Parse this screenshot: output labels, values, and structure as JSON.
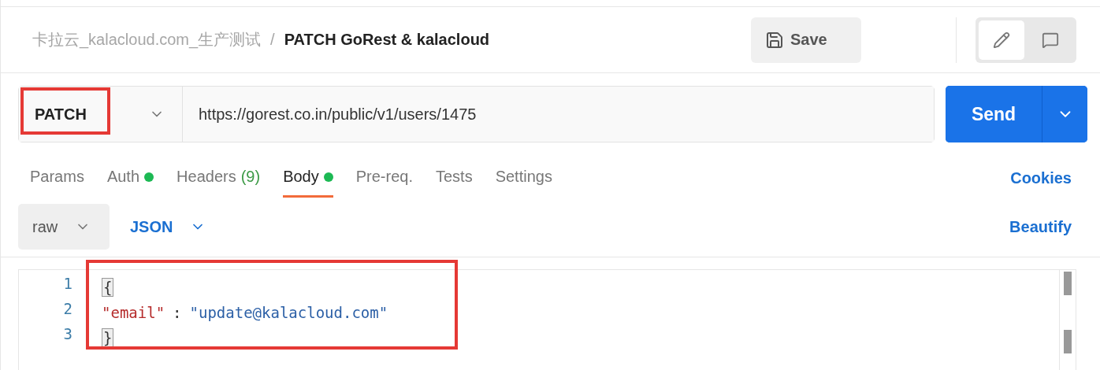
{
  "breadcrumb": {
    "collection": "卡拉云_kalacloud.com_生产测试",
    "separator": "/",
    "request": "PATCH GoRest & kalacloud"
  },
  "save_button": {
    "label": "Save"
  },
  "view_modes": [
    {
      "kind": "edit",
      "selected": true
    },
    {
      "kind": "comment",
      "selected": false
    }
  ],
  "request": {
    "method": "PATCH",
    "method_highlighted": true,
    "url": "https://gorest.co.in/public/v1/users/1475",
    "send": "Send"
  },
  "tabs": [
    {
      "label": "Params",
      "selected": false,
      "dot": false
    },
    {
      "label": "Auth",
      "selected": false,
      "dot": true
    },
    {
      "label": "Headers",
      "count": "(9)",
      "selected": false,
      "dot": false
    },
    {
      "label": "Body",
      "selected": true,
      "dot": true
    },
    {
      "label": "Pre-req.",
      "selected": false,
      "dot": false
    },
    {
      "label": "Tests",
      "selected": false,
      "dot": false
    },
    {
      "label": "Settings",
      "selected": false,
      "dot": false
    }
  ],
  "cookies_link": "Cookies",
  "body_options": {
    "mode": "raw",
    "language": "JSON",
    "beautify": "Beautify"
  },
  "editor": {
    "highlighted": true,
    "lines": [
      {
        "number": "1",
        "tokens": [
          {
            "kind": "brace",
            "text": "{"
          }
        ]
      },
      {
        "number": "2",
        "tokens": [
          {
            "kind": "key",
            "text": "\"email\""
          },
          {
            "kind": "punct",
            "text": ":"
          },
          {
            "kind": "string",
            "text": "\"update@kalacloud.com\""
          }
        ]
      },
      {
        "number": "3",
        "tokens": [
          {
            "kind": "brace",
            "text": "}"
          }
        ]
      }
    ]
  }
}
